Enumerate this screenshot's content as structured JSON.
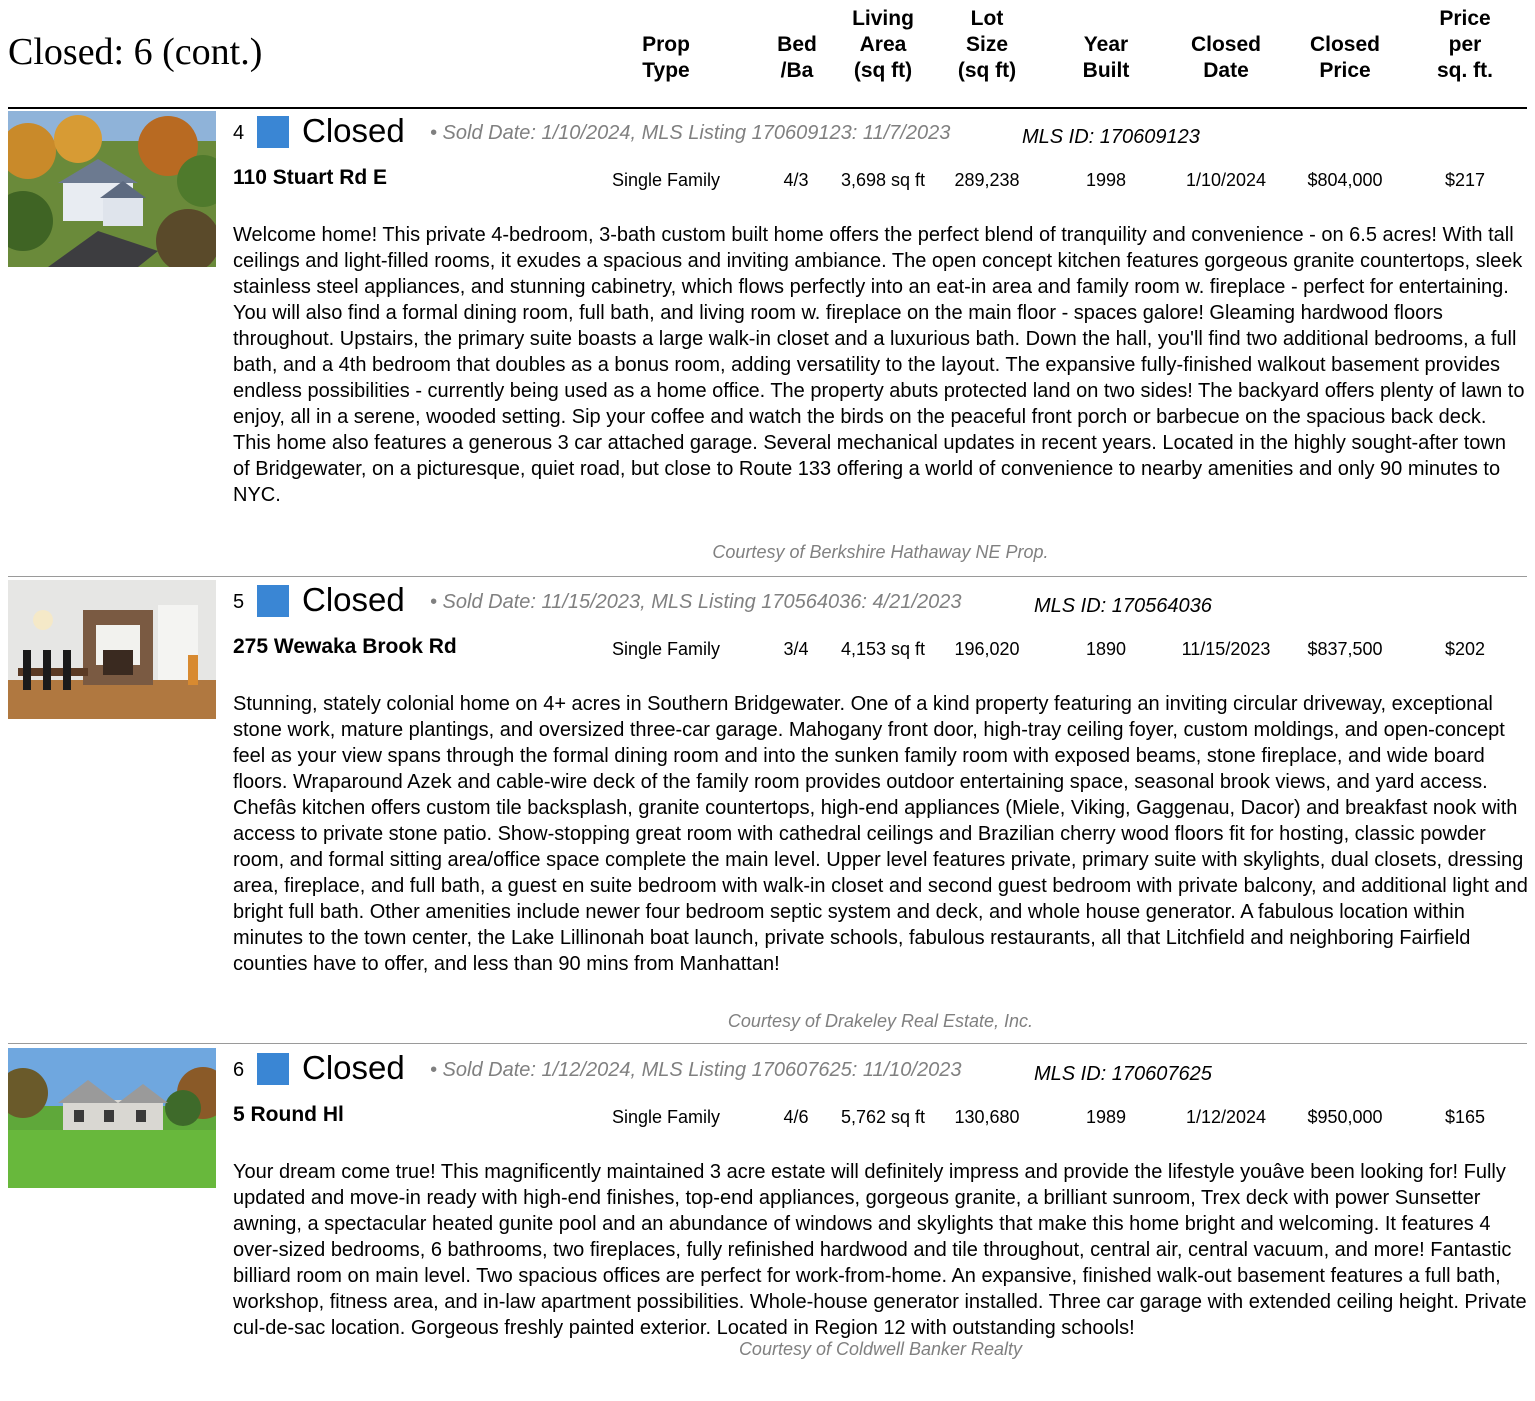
{
  "page": {
    "title": "Closed: 6 (cont.)",
    "columns": {
      "prop_type": [
        "Prop",
        "Type"
      ],
      "bed_ba": [
        "Bed",
        "/Ba"
      ],
      "living_area": [
        "Living",
        "Area",
        "(sq ft)"
      ],
      "lot_size": [
        "Lot",
        "Size",
        "(sq ft)"
      ],
      "year_built": [
        "Year",
        "Built"
      ],
      "closed_date": [
        "Closed",
        "Date"
      ],
      "closed_price": [
        "Closed",
        "Price"
      ],
      "price_per_sqft": [
        "Price",
        "per",
        "sq. ft."
      ]
    }
  },
  "colors": {
    "status_square": "#3a86d4",
    "muted_text": "#808080"
  },
  "listings": [
    {
      "number": "4",
      "status": "Closed",
      "sold_info": "• Sold Date: 1/10/2024, MLS Listing 170609123: 11/7/2023",
      "mls_id": "MLS ID: 170609123",
      "address": "110 Stuart Rd E",
      "prop_type": "Single Family",
      "bed_ba": "4/3",
      "living_area": "3,698 sq ft",
      "lot_size": "289,238",
      "year_built": "1998",
      "closed_date": "1/10/2024",
      "closed_price": "$804,000",
      "price_per_sqft": "$217",
      "description": "Welcome home! This private 4-bedroom, 3-bath custom built home offers the perfect blend of tranquility and convenience - on 6.5 acres! With tall ceilings and light-filled rooms, it exudes a spacious and inviting ambiance. The open concept kitchen features gorgeous granite countertops, sleek stainless steel appliances, and stunning cabinetry, which flows perfectly into an eat-in area and family room w. fireplace - perfect for entertaining. You will also find a formal dining room, full bath, and living room w. fireplace on the main floor - spaces galore! Gleaming hardwood floors throughout. Upstairs, the primary suite boasts a large walk-in closet and a luxurious bath. Down the hall, you'll find two additional bedrooms, a full bath, and a 4th bedroom that doubles as a bonus room, adding versatility to the layout. The expansive fully-finished walkout basement provides endless possibilities - currently being used as a home office. The property abuts protected land on two sides! The backyard offers plenty of lawn to enjoy, all in a serene, wooded setting. Sip your coffee and watch the birds on the peaceful front porch or barbecue on the spacious back deck. This home also features a generous 3 car attached garage. Several mechanical updates in recent years. Located in the highly sought-after town of Bridgewater, on a picturesque, quiet road, but close to Route 133 offering a world of convenience to nearby amenities and only 90 minutes to NYC.",
      "courtesy": "Courtesy of Berkshire Hathaway NE Prop."
    },
    {
      "number": "5",
      "status": "Closed",
      "sold_info": "• Sold Date: 11/15/2023, MLS Listing 170564036: 4/21/2023",
      "mls_id": "MLS ID: 170564036",
      "address": "275 Wewaka Brook Rd",
      "prop_type": "Single Family",
      "bed_ba": "3/4",
      "living_area": "4,153 sq ft",
      "lot_size": "196,020",
      "year_built": "1890",
      "closed_date": "11/15/2023",
      "closed_price": "$837,500",
      "price_per_sqft": "$202",
      "description": "Stunning, stately colonial home on 4+ acres in Southern Bridgewater. One of a kind property featuring an inviting circular driveway, exceptional stone work, mature plantings, and oversized three-car garage. Mahogany front door, high-tray ceiling foyer, custom moldings, and open-concept feel as your view spans through the formal dining room and into the sunken family room with exposed beams, stone fireplace, and wide board floors. Wraparound Azek and cable-wire deck of the family room provides outdoor entertaining space, seasonal brook views, and yard access. Chefâs kitchen offers custom tile backsplash, granite countertops, high-end appliances (Miele, Viking, Gaggenau, Dacor) and breakfast nook with access to private stone patio. Show-stopping great room with cathedral ceilings and Brazilian cherry wood floors fit for hosting, classic powder room, and formal sitting area/office space complete the main level. Upper level features private, primary suite with skylights, dual closets, dressing area, fireplace, and full bath, a guest en suite bedroom with walk-in closet and second guest bedroom with private balcony, and additional light and bright full bath. Other amenities include newer four bedroom septic system and deck, and whole house generator. A fabulous location within minutes to the town center, the Lake Lillinonah boat launch, private schools, fabulous restaurants, all that Litchfield and neighboring Fairfield counties have to offer, and less than 90 mins from Manhattan!",
      "courtesy": "Courtesy of Drakeley Real Estate, Inc."
    },
    {
      "number": "6",
      "status": "Closed",
      "sold_info": "• Sold Date: 1/12/2024, MLS Listing 170607625: 11/10/2023",
      "mls_id": "MLS ID: 170607625",
      "address": "5 Round Hl",
      "prop_type": "Single Family",
      "bed_ba": "4/6",
      "living_area": "5,762 sq ft",
      "lot_size": "130,680",
      "year_built": "1989",
      "closed_date": "1/12/2024",
      "closed_price": "$950,000",
      "price_per_sqft": "$165",
      "description": "Your dream come true! This magnificently maintained 3 acre estate will definitely impress and provide the lifestyle youâve been looking for! Fully updated and move-in ready with high-end finishes, top-end appliances, gorgeous granite, a brilliant sunroom, Trex deck with power Sunsetter awning, a spectacular heated gunite pool and an abundance of windows and skylights that make this home bright and welcoming. It features 4 over-sized bedrooms, 6 bathrooms, two fireplaces, fully refinished hardwood and tile throughout, central air, central vacuum, and more! Fantastic billiard room on main level. Two spacious offices are perfect for work-from-home. An expansive, finished walk-out basement features a full bath, workshop, fitness area, and in-law apartment possibilities. Whole-house generator installed. Three car garage with extended ceiling height. Private cul-de-sac location. Gorgeous freshly painted exterior. Located in Region 12 with outstanding schools!",
      "courtesy": "Courtesy of Coldwell Banker Realty"
    }
  ]
}
